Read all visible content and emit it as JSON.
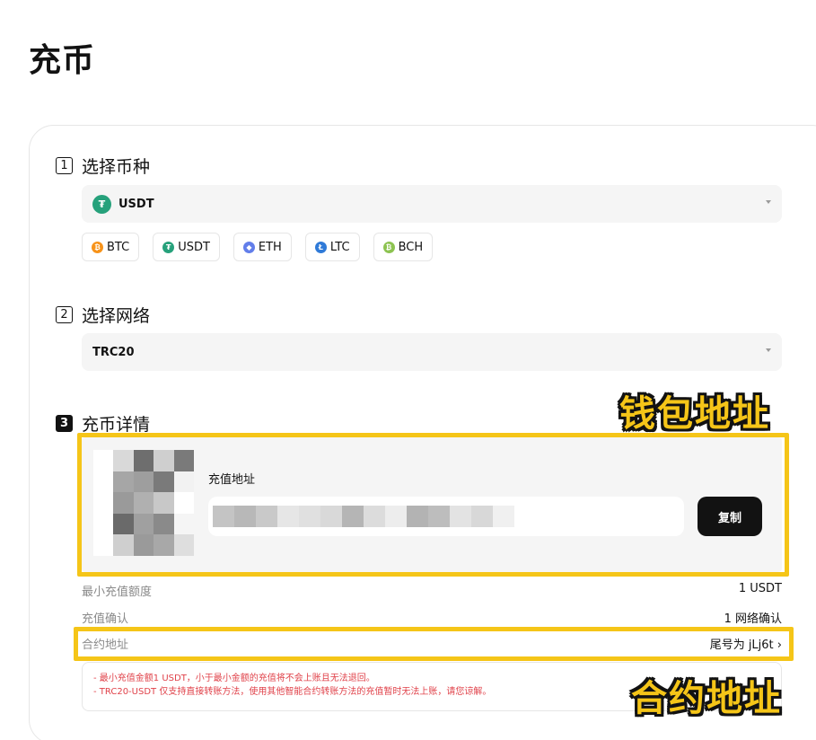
{
  "page": {
    "title": "充币"
  },
  "steps": [
    {
      "num": "1",
      "label": "选择币种"
    },
    {
      "num": "2",
      "label": "选择网络"
    },
    {
      "num": "3",
      "label": "充币详情"
    }
  ],
  "coin_select": {
    "value": "USDT",
    "icon_letter": "₮",
    "icon_color": "#26a17b"
  },
  "quick_coins": [
    {
      "label": "BTC",
      "icon": "btc-icon",
      "glyph": "₿",
      "color": "#f7931a"
    },
    {
      "label": "USDT",
      "icon": "usdt-icon",
      "glyph": "₮",
      "color": "#26a17b"
    },
    {
      "label": "ETH",
      "icon": "eth-icon",
      "glyph": "◆",
      "color": "#627eea"
    },
    {
      "label": "LTC",
      "icon": "ltc-icon",
      "glyph": "Ł",
      "color": "#2f7ad8"
    },
    {
      "label": "BCH",
      "icon": "bch-icon",
      "glyph": "₿",
      "color": "#8dc351"
    }
  ],
  "network_select": {
    "value": "TRC20"
  },
  "details": {
    "address_label": "充值地址",
    "copy_label": "复制"
  },
  "info_rows": [
    {
      "key": "最小充值额度",
      "value": "1 USDT"
    },
    {
      "key": "充值确认",
      "value": "1 网络确认"
    },
    {
      "key": "合约地址",
      "value": "尾号为 jLj6t ›"
    }
  ],
  "notes": [
    "- 最小充值金额1 USDT，小于最小金额的充值将不会上账且无法退回。",
    "- TRC20-USDT 仅支持直接转账方法，使用其他智能合约转账方法的充值暂时无法上账，请您谅解。"
  ],
  "callouts": {
    "wallet": "钱包地址",
    "contract": "合约地址"
  },
  "colors": {
    "highlight": "#f5c518",
    "accent_dark": "#121212",
    "warning": "#e0424a"
  }
}
